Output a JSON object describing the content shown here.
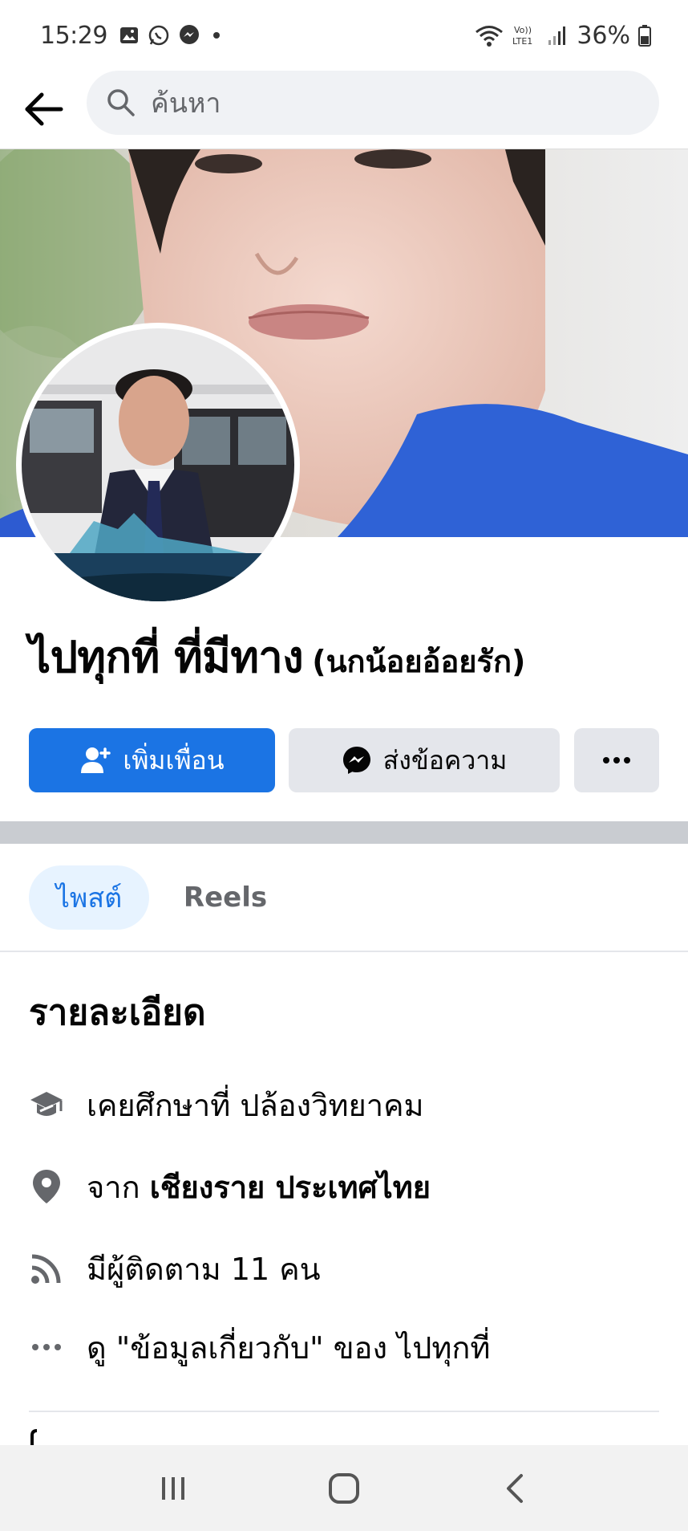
{
  "status_bar": {
    "time": "15:29",
    "network": "LTE1",
    "battery": "36%"
  },
  "search": {
    "placeholder": "ค้นหา"
  },
  "profile": {
    "name": "ไปทุกที่ ที่มีทาง",
    "alternate_name": "(นกน้อยอ้อยรัก)"
  },
  "actions": {
    "add_friend": "เพิ่มเพื่อน",
    "message": "ส่งข้อความ"
  },
  "tabs": {
    "posts": "ไพสต์",
    "reels": "Reels"
  },
  "details": {
    "title": "รายละเอียด",
    "education": "เคยศึกษาที่ ปล้องวิทยาคม",
    "from_prefix": "จาก ",
    "from_place": "เชียงราย ประเทศไทย",
    "followers": "มีผู้ติดตาม 11 คน",
    "about": "ดู \"ข้อมูลเกี่ยวกับ\" ของ ไปทุกที่"
  },
  "colors": {
    "primary": "#1b74e4",
    "secondary_button": "#e4e6eb",
    "tab_active_bg": "#e7f3ff"
  },
  "icons": {
    "back": "arrow-left-icon",
    "search": "search-icon",
    "add_friend": "person-plus-icon",
    "messenger": "messenger-icon",
    "more": "more-dots-icon",
    "education": "graduation-cap-icon",
    "location": "location-pin-icon",
    "followers": "rss-icon",
    "about": "more-dots-icon"
  }
}
